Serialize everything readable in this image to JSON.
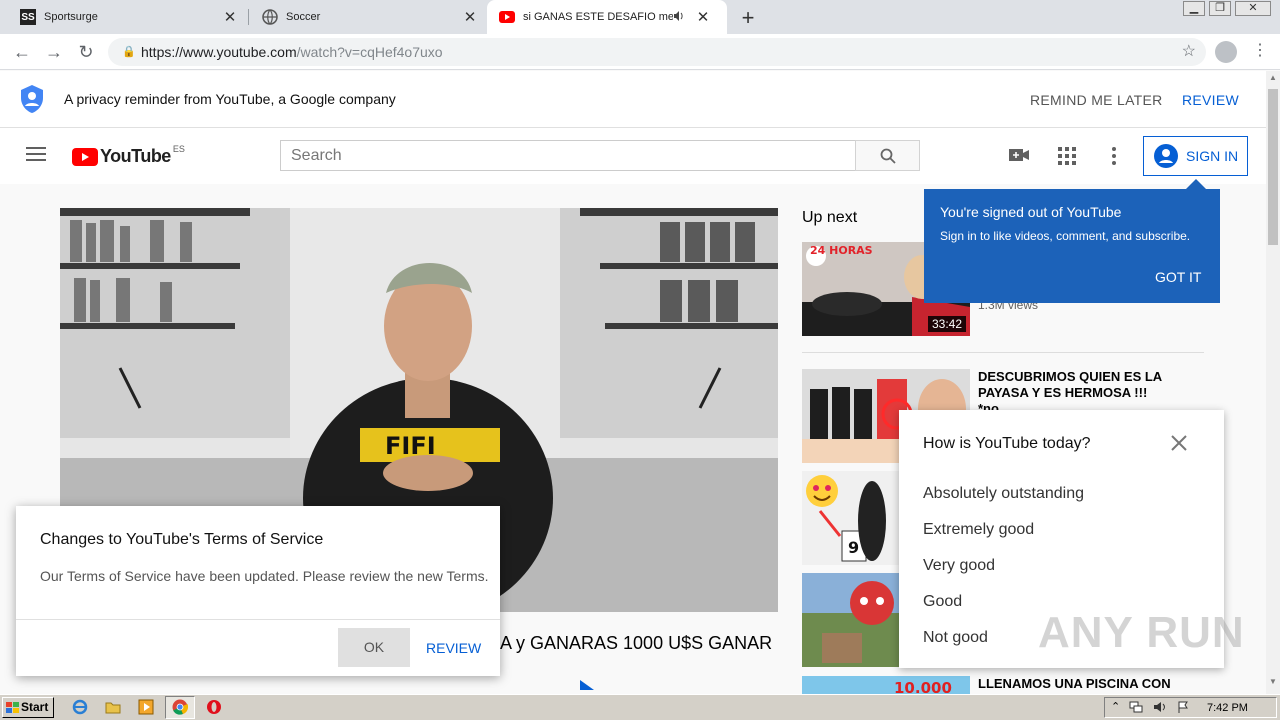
{
  "browser": {
    "tabs": [
      {
        "title": "Sportsurge",
        "favicon": "SS"
      },
      {
        "title": "Soccer",
        "favicon": "globe-icon"
      },
      {
        "title": "si GANAS ESTE DESAFIO me CO",
        "favicon": "youtube-icon",
        "active": true
      }
    ],
    "close_glyph": "✕",
    "newtab_glyph": "+",
    "url_host": "https://www.youtube.com",
    "url_path": "/watch?v=cqHef4o7uxo"
  },
  "privacy_bar": {
    "text": "A privacy reminder from YouTube, a Google company",
    "remind_label": "REMIND ME LATER",
    "review_label": "REVIEW"
  },
  "masthead": {
    "logo_text": "YouTube",
    "region": "ES",
    "search_placeholder": "Search",
    "signin_label": "SIGN IN"
  },
  "tooltip": {
    "title": "You're signed out of YouTube",
    "body": "Sign in to like videos, comment, and subscribe.",
    "button": "GOT IT"
  },
  "upnext": {
    "label": "Up next",
    "items": [
      {
        "title": "",
        "meta": "1.3M views",
        "duration": "33:42",
        "badge": "24 HORAS"
      },
      {
        "title": "DESCUBRIMOS QUIEN ES LA PAYASA Y ES HERMOSA !!! *no...",
        "meta": "",
        "duration": ""
      },
      {
        "title": "",
        "meta": "",
        "duration": "",
        "badge": "9"
      },
      {
        "title": "",
        "meta": "",
        "duration": ""
      },
      {
        "title": "LLENAMOS UNA PISCINA CON",
        "meta": "",
        "duration": "",
        "badge": "10.000"
      }
    ]
  },
  "video": {
    "title_visible": "A y GANARAS 1000 U$S GANAR",
    "shirt_text": "FIFI"
  },
  "survey": {
    "question": "How is YouTube today?",
    "options": [
      "Absolutely outstanding",
      "Extremely good",
      "Very good",
      "Good",
      "Not good"
    ]
  },
  "tos_dialog": {
    "title": "Changes to YouTube's Terms of Service",
    "body": "Our Terms of Service have been updated. Please review the new Terms.",
    "ok_label": "OK",
    "review_label": "REVIEW"
  },
  "taskbar": {
    "start_label": "Start",
    "time": "7:42 PM"
  },
  "watermark": "ANY RUN",
  "colors": {
    "youtube_red": "#ff0000",
    "link_blue": "#065fd4",
    "tooltip_blue": "#1c62b9"
  }
}
